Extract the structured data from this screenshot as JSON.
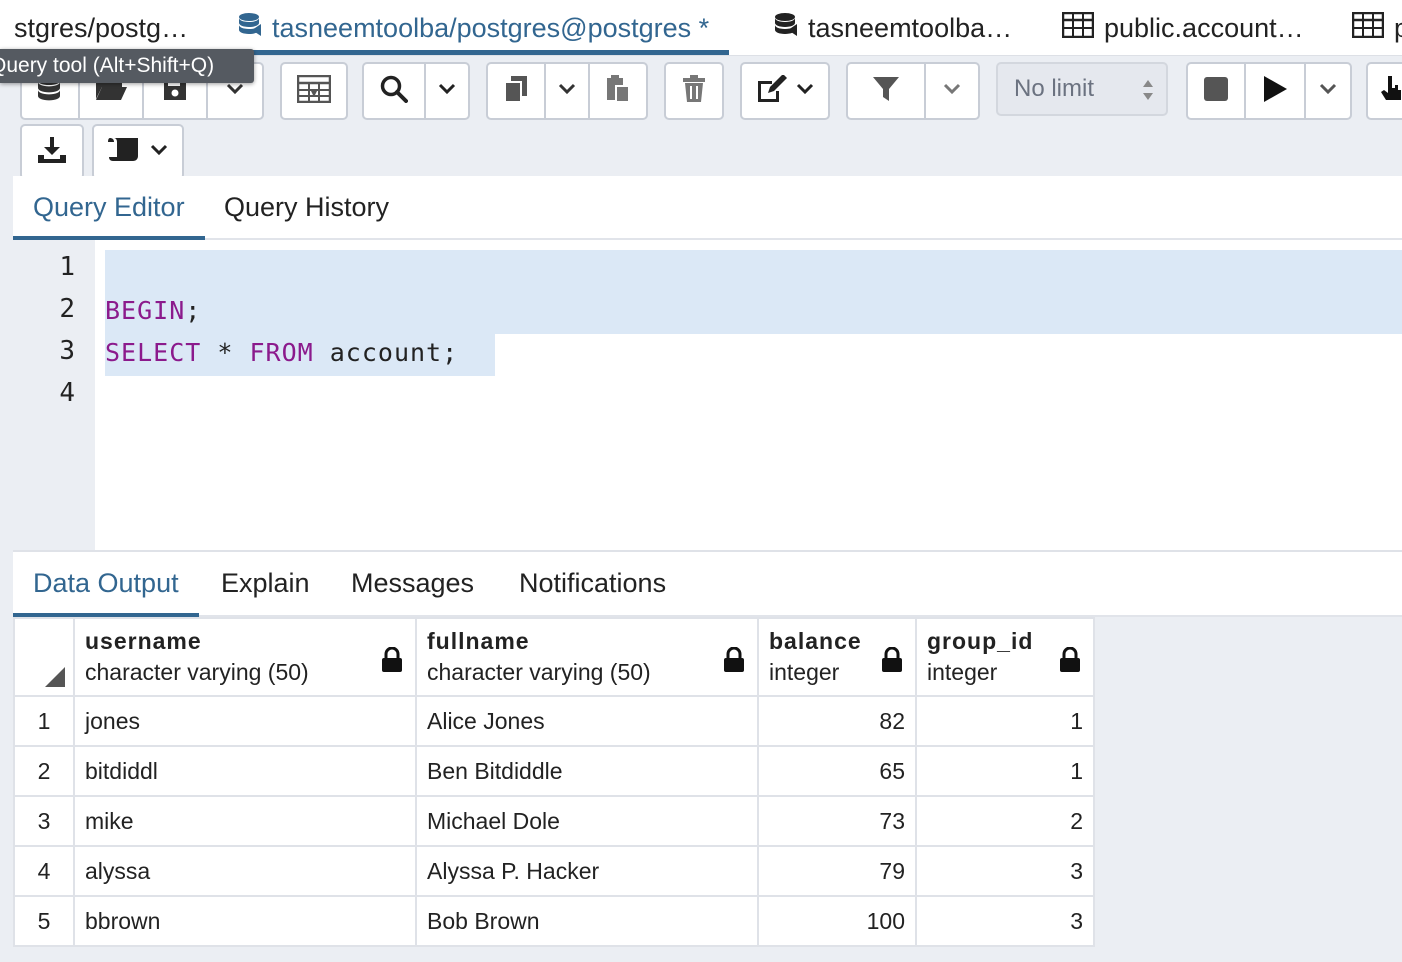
{
  "tabs": [
    {
      "label": "stgres/postg…",
      "icon": "none"
    },
    {
      "label": "tasneemtoolba/postgres@postgres *",
      "icon": "database-icon",
      "active": true
    },
    {
      "label": "tasneemtoolba…",
      "icon": "database-icon"
    },
    {
      "label": "public.account…",
      "icon": "table-icon"
    },
    {
      "label": "p",
      "icon": "table-icon"
    }
  ],
  "tooltip": "Query tool (Alt+Shift+Q)",
  "toolbar": {
    "limit_value": "No limit"
  },
  "editor_tabs": [
    "Query Editor",
    "Query History"
  ],
  "editor": {
    "line_numbers": [
      "1",
      "2",
      "3",
      "4"
    ],
    "lines": [
      {
        "kw1": "",
        "rest": ""
      },
      {
        "kw1": "BEGIN",
        "rest": ";"
      },
      {
        "kw1": "SELECT",
        "mid": " * ",
        "kw2": "FROM",
        "rest": " account;"
      },
      {
        "kw1": "",
        "rest": ""
      }
    ]
  },
  "output_tabs": [
    "Data Output",
    "Explain",
    "Messages",
    "Notifications"
  ],
  "grid": {
    "columns": [
      {
        "name": "username",
        "type": "character varying (50)"
      },
      {
        "name": "fullname",
        "type": "character varying (50)"
      },
      {
        "name": "balance",
        "type": "integer"
      },
      {
        "name": "group_id",
        "type": "integer"
      }
    ],
    "rows": [
      {
        "n": "1",
        "username": "jones",
        "fullname": "Alice Jones",
        "balance": "82",
        "group_id": "1"
      },
      {
        "n": "2",
        "username": "bitdiddl",
        "fullname": "Ben Bitdiddle",
        "balance": "65",
        "group_id": "1"
      },
      {
        "n": "3",
        "username": "mike",
        "fullname": "Michael Dole",
        "balance": "73",
        "group_id": "2"
      },
      {
        "n": "4",
        "username": "alyssa",
        "fullname": "Alyssa P. Hacker",
        "balance": "79",
        "group_id": "3"
      },
      {
        "n": "5",
        "username": "bbrown",
        "fullname": "Bob Brown",
        "balance": "100",
        "group_id": "3"
      }
    ]
  },
  "colors": {
    "accent": "#326690",
    "keyword": "#8b1a8c",
    "selection": "#dbe8f6"
  }
}
